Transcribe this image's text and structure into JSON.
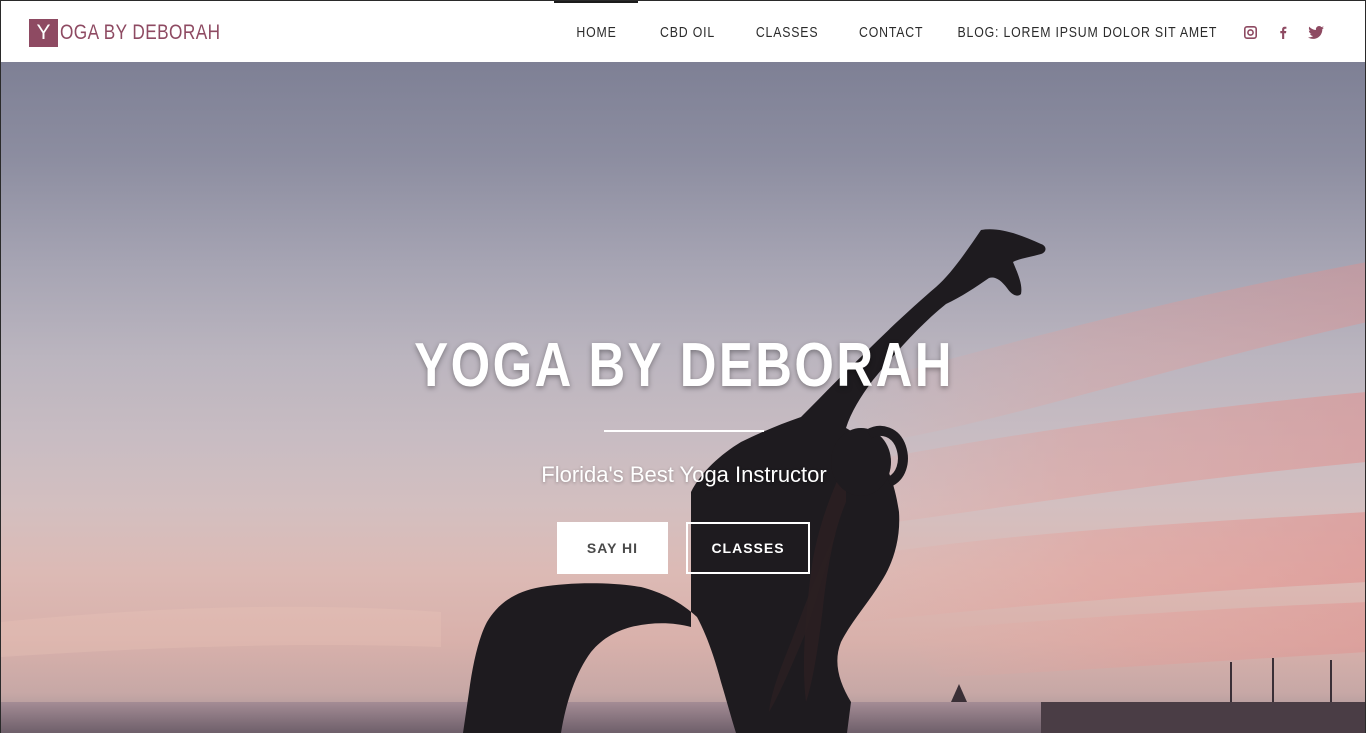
{
  "header": {
    "logo_letter": "Y",
    "logo_rest": "OGA BY DEBORAH",
    "nav": [
      {
        "label": "HOME"
      },
      {
        "label": "CBD OIL"
      },
      {
        "label": "CLASSES"
      },
      {
        "label": "CONTACT"
      },
      {
        "label": "BLOG: LOREM IPSUM DOLOR SIT AMET"
      }
    ],
    "social": [
      "instagram-icon",
      "facebook-icon",
      "twitter-icon"
    ]
  },
  "hero": {
    "title": "YOGA BY DEBORAH",
    "subtitle": "Florida's Best Yoga Instructor",
    "primary_button": "SAY HI",
    "secondary_button": "CLASSES"
  },
  "colors": {
    "brand": "#8e4a62",
    "nav_text": "#2b2b2b",
    "hero_text": "#ffffff"
  }
}
